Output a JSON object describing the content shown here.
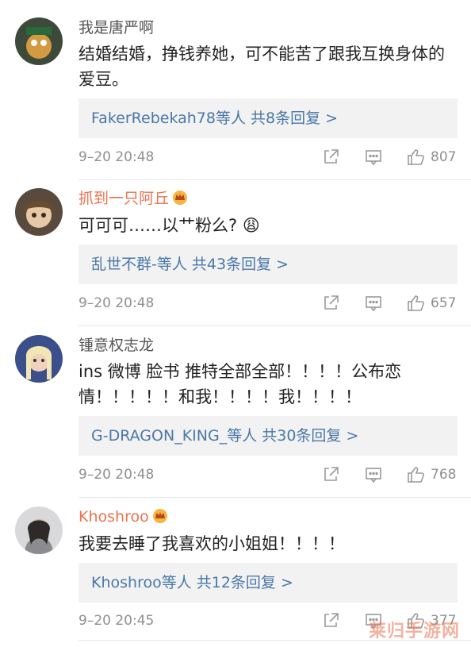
{
  "comments": [
    {
      "username": "我是唐严啊",
      "vip": false,
      "text": "结婚结婚，挣钱养她，可不能苦了跟我互换身体的爱豆。",
      "reply_prefix": "FakerRebekah78等人 ",
      "reply_count": "共8条回复 >",
      "time": "9–20 20:48",
      "likes": "807"
    },
    {
      "username": "抓到一只阿丘",
      "vip": true,
      "text": "可可可……以艹粉么? 😩",
      "reply_prefix": "乱世不群-等人 ",
      "reply_count": "共43条回复 >",
      "time": "9–20 20:48",
      "likes": "657"
    },
    {
      "username": "锺意权志龙",
      "vip": false,
      "text": "ins 微博 脸书 推特全部全部！！！！公布恋情！！！！！和我！！！！我！！！！",
      "reply_prefix": "G-DRAGON_KING_等人 ",
      "reply_count": "共30条回复 >",
      "time": "9–20 20:48",
      "likes": "768"
    },
    {
      "username": "Khoshroo",
      "vip": true,
      "text": "我要去睡了我喜欢的小姐姐！！！！",
      "reply_prefix": "Khoshroo等人 ",
      "reply_count": "共12条回复 >",
      "time": "9–20 20:45",
      "likes": "377"
    }
  ],
  "icons": {
    "share": "share-icon",
    "comment": "comment-icon",
    "like": "thumbs-up-icon",
    "vip": "crown-badge-icon"
  },
  "colors": {
    "username_vip": "#eb7350",
    "link": "#4a78a8",
    "meta": "#8f8f8f",
    "reply_bg": "#f2f2f2"
  },
  "watermark": "莱归手游网"
}
